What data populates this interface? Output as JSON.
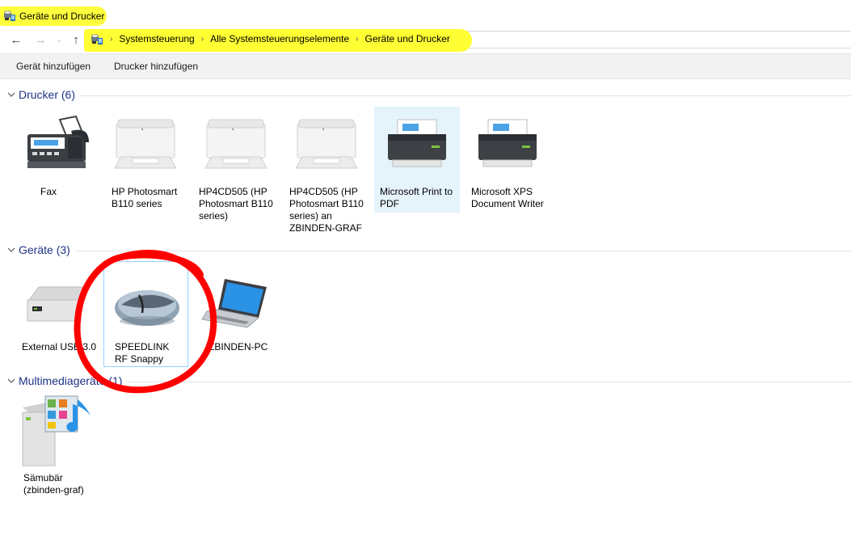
{
  "window": {
    "title": "Geräte und Drucker"
  },
  "nav": {
    "back": "←",
    "forward": "→",
    "dropdown": "⌄",
    "up": "↑"
  },
  "breadcrumbs": [
    {
      "label": "Systemsteuerung"
    },
    {
      "label": "Alle Systemsteuerungselemente"
    },
    {
      "label": "Geräte und Drucker"
    }
  ],
  "breadcrumb_separator": "›",
  "toolbar": {
    "add_device": "Gerät hinzufügen",
    "add_printer": "Drucker hinzufügen"
  },
  "groups": {
    "printers": {
      "title": "Drucker (6)",
      "items": [
        {
          "label": "Fax",
          "icon": "fax-icon"
        },
        {
          "label": "HP Photosmart B110 series",
          "icon": "printer-icon"
        },
        {
          "label": "HP4CD505 (HP Photosmart B110 series)",
          "icon": "printer-icon"
        },
        {
          "label": "HP4CD505 (HP Photosmart B110 series) an ZBINDEN-GRAF",
          "icon": "printer-icon"
        },
        {
          "label": "Microsoft Print to PDF",
          "icon": "virtual-printer-icon"
        },
        {
          "label": "Microsoft XPS Document Writer",
          "icon": "virtual-printer-icon"
        }
      ]
    },
    "devices": {
      "title": "Geräte (3)",
      "items": [
        {
          "label": "External USB 3.0",
          "icon": "external-drive-icon"
        },
        {
          "label": "SPEEDLINK RF Snappy",
          "icon": "mouse-icon"
        },
        {
          "label": "ZBINDEN-PC",
          "icon": "laptop-icon"
        }
      ]
    },
    "multimedia": {
      "title": "Multimediageräte (1)",
      "items": [
        {
          "label": "Sämubär (zbinden-graf)",
          "icon": "media-server-icon"
        }
      ]
    }
  },
  "colors": {
    "highlight": "#ffff33",
    "group_header": "#1e3287",
    "selected_bg": "#e5f3fb",
    "annotation_red": "#ff0000"
  }
}
